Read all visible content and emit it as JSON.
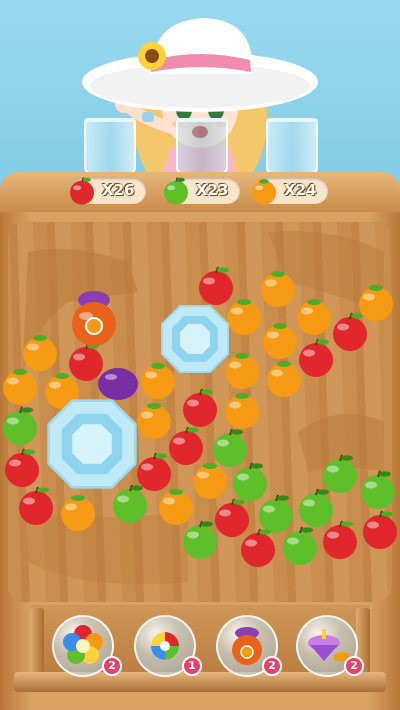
{
  "targets": [
    {
      "fruit": "red-apple",
      "count": "X26"
    },
    {
      "fruit": "green-apple",
      "count": "X23"
    },
    {
      "fruit": "orange",
      "count": "X24"
    }
  ],
  "boosters": [
    {
      "icon": "rainbow-flower-icon",
      "count": "2"
    },
    {
      "icon": "color-swirl-icon",
      "count": "1"
    },
    {
      "icon": "fruit-jar-icon",
      "count": "2"
    },
    {
      "icon": "spinning-top-icon",
      "count": "2"
    }
  ],
  "colors": {
    "red": "#e0272b",
    "green": "#5fbf2a",
    "orange": "#f59a12",
    "purple": "#7a2ea6",
    "badge": "#e8406a"
  }
}
